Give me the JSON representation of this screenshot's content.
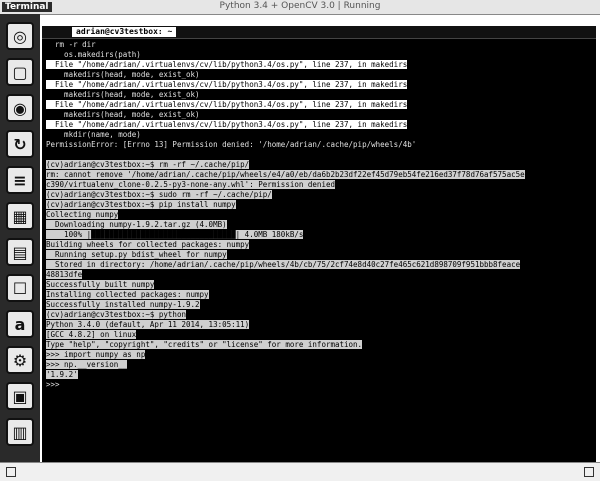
{
  "window": {
    "title": "Python 3.4 + OpenCV 3.0 | Running"
  },
  "terminal_label": "Terminal",
  "tab_label": "adrian@cv3testbox: ~",
  "launcher": {
    "items": [
      {
        "name": "dash-icon",
        "glyph": "◎"
      },
      {
        "name": "folder-icon",
        "glyph": "▢"
      },
      {
        "name": "browser-icon",
        "glyph": "◉"
      },
      {
        "name": "sync-icon",
        "glyph": "↻"
      },
      {
        "name": "document-icon",
        "glyph": "≡"
      },
      {
        "name": "spreadsheet-icon",
        "glyph": "▦"
      },
      {
        "name": "presentation-icon",
        "glyph": "▤"
      },
      {
        "name": "bag-icon",
        "glyph": "☐"
      },
      {
        "name": "amazon-icon",
        "glyph": "a"
      },
      {
        "name": "settings-icon",
        "glyph": "⚙"
      },
      {
        "name": "terminal-icon",
        "glyph": "▣"
      },
      {
        "name": "trash-icon",
        "glyph": "▥"
      }
    ]
  },
  "lines": [
    "  rm -r dir",
    "    os.makedirs(path)",
    "  File \"/home/adrian/.virtualenvs/cv/lib/python3.4/os.py\", line 237, in makedirs",
    "    makedirs(head, mode, exist_ok)",
    "  File \"/home/adrian/.virtualenvs/cv/lib/python3.4/os.py\", line 237, in makedirs",
    "    makedirs(head, mode, exist_ok)",
    "  File \"/home/adrian/.virtualenvs/cv/lib/python3.4/os.py\", line 237, in makedirs",
    "    makedirs(head, mode, exist_ok)",
    "  File \"/home/adrian/.virtualenvs/cv/lib/python3.4/os.py\", line 237, in makedirs",
    "    mkdir(name, mode)",
    "PermissionError: [Errno 13] Permission denied: '/home/adrian/.cache/pip/wheels/4b'",
    "",
    "(cv)adrian@cv3testbox:~$ rm -rf ~/.cache/pip/",
    "rm: cannot remove '/home/adrian/.cache/pip/wheels/e4/a0/eb/da6b2b23df22ef45d79eb54fe216ed37f78d76af575ac5e",
    "c390/virtualenv_clone-0.2.5-py3-none-any.whl': Permission denied",
    "(cv)adrian@cv3testbox:~$ sudo rm -rf ~/.cache/pip/",
    "(cv)adrian@cv3testbox:~$ pip install numpy",
    "Collecting numpy",
    "  Downloading numpy-1.9.2.tar.gz (4.0MB)",
    "    100% |████████████████████████████████| 4.0MB 180kB/s",
    "Building wheels for collected packages: numpy",
    "  Running setup.py bdist_wheel for numpy",
    "  Stored in directory: /home/adrian/.cache/pip/wheels/4b/cb/75/2cf74e8d40c27fe465c621d898709f951bbb8feace",
    "48813dfe",
    "Successfully built numpy",
    "Installing collected packages: numpy",
    "Successfully installed numpy-1.9.2",
    "(cv)adrian@cv3testbox:~$ python",
    "Python 3.4.0 (default, Apr 11 2014, 13:05:11)",
    "[GCC 4.8.2] on linux",
    "Type \"help\", \"copyright\", \"credits\" or \"license\" for more information.",
    ">>> import numpy as np",
    ">>> np.__version__",
    "'1.9.2'",
    ">>> "
  ],
  "colors": {
    "terminal_bg": "#000000",
    "launcher_bg": "#2a2a2a"
  }
}
